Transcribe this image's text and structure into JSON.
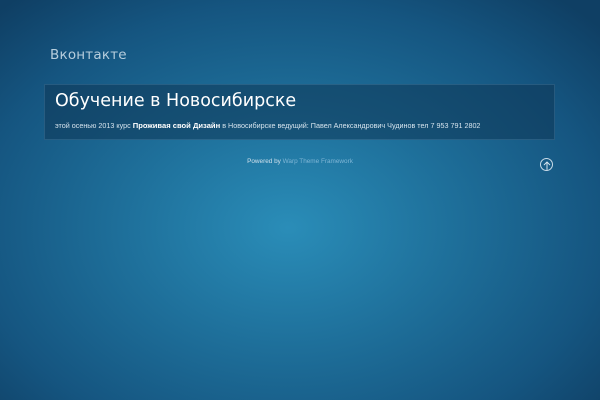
{
  "nav": {
    "link_label": "Вконтакте"
  },
  "article": {
    "title": "Обучение в Новосибирске",
    "text_before": "этой осенью 2013 курс ",
    "text_bold": "Проживая свой Дизайн",
    "text_after": " в Новосибирске ведущий: Павел Александрович Чудинов тел 7 953 791 2802"
  },
  "footer": {
    "powered_by": "Powered by ",
    "framework_link": "Warp Theme Framework"
  },
  "icons": {
    "to_top": "arrow-up-circle-icon"
  }
}
